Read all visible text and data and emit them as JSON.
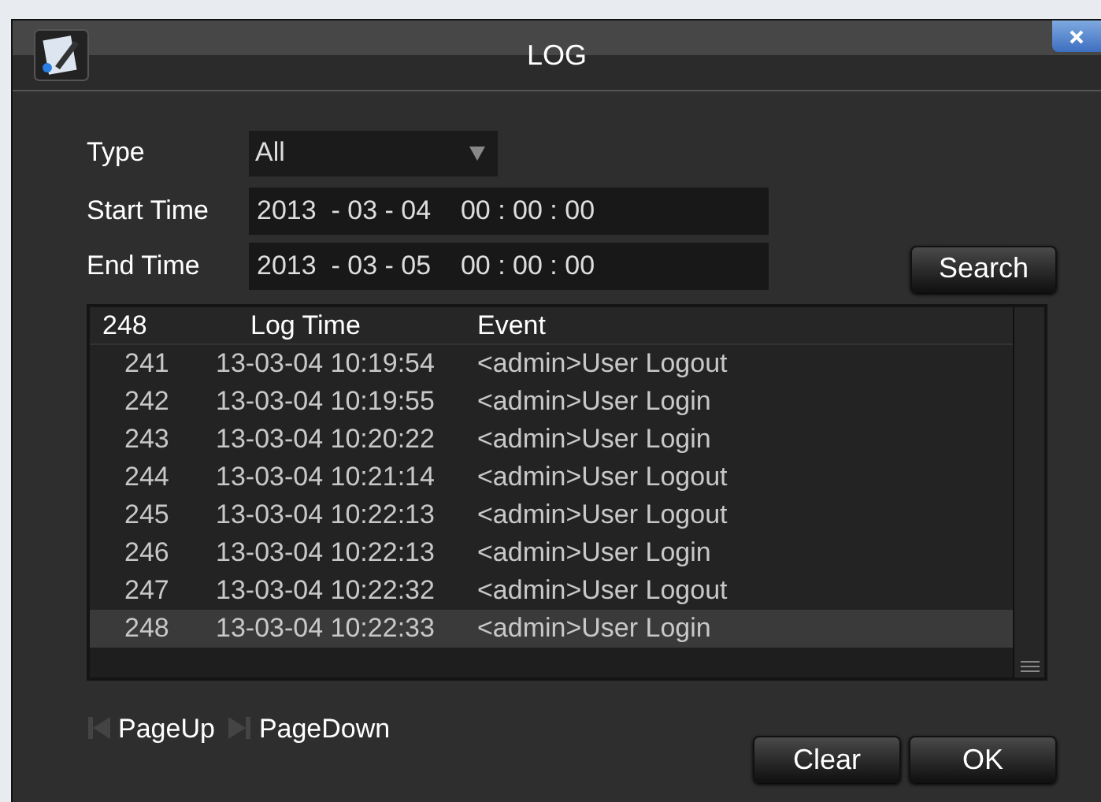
{
  "window": {
    "title": "LOG"
  },
  "filters": {
    "type_label": "Type",
    "type_value": "All",
    "start_label": "Start Time",
    "start_value": "2013  - 03 - 04    00 : 00 : 00",
    "end_label": "End Time",
    "end_value": "2013  - 03 - 05    00 : 00 : 00",
    "search_button": "Search"
  },
  "table": {
    "columns": [
      "248",
      "Log Time",
      "Event"
    ],
    "rows": [
      {
        "no": "241",
        "time": "13-03-04 10:19:54",
        "event": "<admin>User Logout",
        "selected": false
      },
      {
        "no": "242",
        "time": "13-03-04 10:19:55",
        "event": "<admin>User Login",
        "selected": false
      },
      {
        "no": "243",
        "time": "13-03-04 10:20:22",
        "event": "<admin>User Login",
        "selected": false
      },
      {
        "no": "244",
        "time": "13-03-04 10:21:14",
        "event": "<admin>User Logout",
        "selected": false
      },
      {
        "no": "245",
        "time": "13-03-04 10:22:13",
        "event": "<admin>User Logout",
        "selected": false
      },
      {
        "no": "246",
        "time": "13-03-04 10:22:13",
        "event": "<admin>User Login",
        "selected": false
      },
      {
        "no": "247",
        "time": "13-03-04 10:22:32",
        "event": "<admin>User Logout",
        "selected": false
      },
      {
        "no": "248",
        "time": "13-03-04 10:22:33",
        "event": "<admin>User Login",
        "selected": true
      }
    ]
  },
  "footer": {
    "page_up": "PageUp",
    "page_down": "PageDown",
    "buttons": [
      "Clear",
      "OK"
    ]
  }
}
